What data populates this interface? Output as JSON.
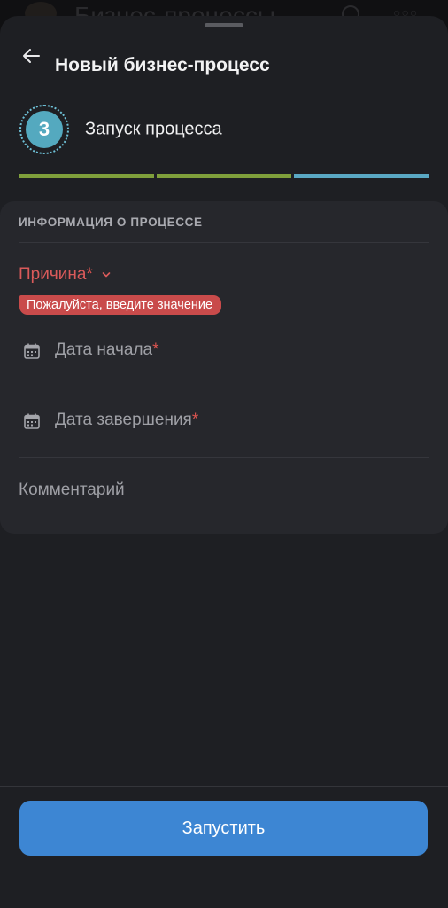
{
  "background": {
    "title": "Бизнес-процессы"
  },
  "header": {
    "back_icon": "arrow-left-icon",
    "title": "Новый бизнес-процесс"
  },
  "step": {
    "number": "3",
    "title": "Запуск процесса",
    "progress_colors": [
      "#7f9f3b",
      "#7f9f3b",
      "#5aa8c3"
    ]
  },
  "form": {
    "section_title": "ИНФОРМАЦИЯ О ПРОЦЕССЕ",
    "reason": {
      "label": "Причина",
      "required_mark": "*",
      "error": "Пожалуйста, введите значение"
    },
    "start_date": {
      "label": "Дата начала",
      "required_mark": "*",
      "icon": "calendar-icon"
    },
    "end_date": {
      "label": "Дата завершения",
      "required_mark": "*",
      "icon": "calendar-icon"
    },
    "comment": {
      "label": "Комментарий"
    }
  },
  "actions": {
    "submit_label": "Запустить"
  },
  "colors": {
    "accent": "#3d86d3",
    "error": "#c94b4b",
    "step": "#54a9bf"
  }
}
